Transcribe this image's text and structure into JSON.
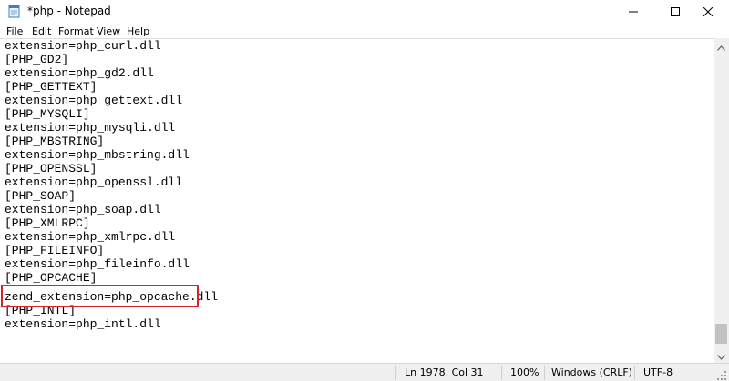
{
  "window": {
    "title": "*php - Notepad",
    "icon": "notepad-icon",
    "controls": [
      "minimize-icon",
      "maximize-icon",
      "close-icon"
    ]
  },
  "menu": [
    "File",
    "Edit",
    "Format",
    "View",
    "Help"
  ],
  "editor": {
    "lines": [
      "extension=php_curl.dll",
      "[PHP_GD2]",
      "extension=php_gd2.dll",
      "[PHP_GETTEXT]",
      "extension=php_gettext.dll",
      "[PHP_MYSQLI]",
      "extension=php_mysqli.dll",
      "[PHP_MBSTRING]",
      "extension=php_mbstring.dll",
      "[PHP_OPENSSL]",
      "extension=php_openssl.dll",
      "[PHP_SOAP]",
      "extension=php_soap.dll",
      "[PHP_XMLRPC]",
      "extension=php_xmlrpc.dll",
      "[PHP_FILEINFO]",
      "extension=php_fileinfo.dll",
      "[PHP_OPCACHE]",
      "zend_extension=php_opcache.dll",
      "[PHP_INTL]",
      "extension=php_intl.dll"
    ],
    "highlight_color": "#d8232a"
  },
  "statusbar": {
    "position": "Ln 1978, Col 31",
    "zoom": "100%",
    "line_ending": "Windows (CRLF)",
    "encoding": "UTF-8"
  }
}
